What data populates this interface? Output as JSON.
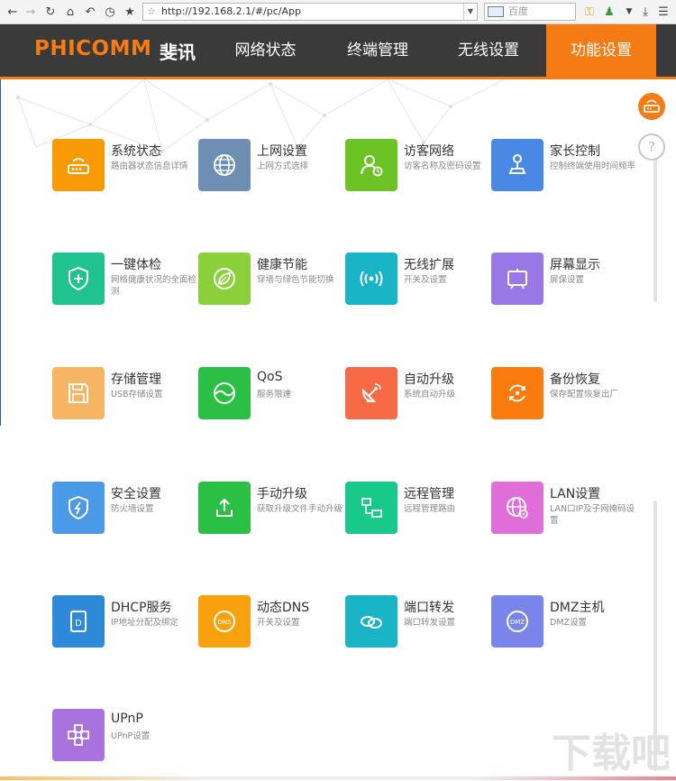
{
  "browser": {
    "url": "http://192.168.2.1/#/pc/App",
    "search_placeholder": "百度"
  },
  "header": {
    "brand_en": "PHICOMM",
    "brand_cn": "斐讯",
    "menu": [
      {
        "label": "网络状态",
        "active": false
      },
      {
        "label": "终端管理",
        "active": false
      },
      {
        "label": "无线设置",
        "active": false
      },
      {
        "label": "功能设置",
        "active": true
      }
    ]
  },
  "colors": {
    "accent": "#f57c14",
    "header_bg": "#3a3a3a"
  },
  "tiles": [
    {
      "title": "系统状态",
      "desc": "路由器状态信息详情",
      "color": "#f79a05",
      "icon": "router-icon"
    },
    {
      "title": "上网设置",
      "desc": "上网方式选择",
      "color": "#6f8fb2",
      "icon": "globe-icon"
    },
    {
      "title": "访客网络",
      "desc": "访客名称及密码设置",
      "color": "#6dc325",
      "icon": "guest-user-icon"
    },
    {
      "title": "家长控制",
      "desc": "控制终端使用时间频率",
      "color": "#4a88e6",
      "icon": "joystick-icon"
    },
    {
      "title": "一键体检",
      "desc": "网络健康状况的全面检测",
      "color": "#20c28e",
      "icon": "shield-plus-icon"
    },
    {
      "title": "健康节能",
      "desc": "穿墙与绿色节能切换",
      "color": "#8ad03a",
      "icon": "leaf-icon"
    },
    {
      "title": "无线扩展",
      "desc": "开关及设置",
      "color": "#18b4c6",
      "icon": "wireless-icon"
    },
    {
      "title": "屏幕显示",
      "desc": "屏保设置",
      "color": "#9977e4",
      "icon": "screen-icon"
    },
    {
      "title": "存储管理",
      "desc": "USB存储设置",
      "color": "#f6b562",
      "icon": "floppy-icon"
    },
    {
      "title": "QoS",
      "desc": "服务限速",
      "color": "#2cbf45",
      "icon": "qos-icon"
    },
    {
      "title": "自动升级",
      "desc": "系统自动升级",
      "color": "#f66a45",
      "icon": "satellite-icon"
    },
    {
      "title": "备份恢复",
      "desc": "保存配置恢复出厂",
      "color": "#fb7c0e",
      "icon": "restore-icon"
    },
    {
      "title": "安全设置",
      "desc": "防火墙设置",
      "color": "#4a9ae8",
      "icon": "shield-bolt-icon"
    },
    {
      "title": "手动升级",
      "desc": "获取升级文件手动升级",
      "color": "#2cbf45",
      "icon": "upload-icon"
    },
    {
      "title": "远程管理",
      "desc": "远程管理路由",
      "color": "#18c98a",
      "icon": "remote-icon"
    },
    {
      "title": "LAN设置",
      "desc": "LAN口IP及子网掩码设置",
      "color": "#df6ed8",
      "icon": "lan-globe-icon"
    },
    {
      "title": "DHCP服务",
      "desc": "IP地址分配及绑定",
      "color": "#2f89d9",
      "icon": "dhcp-icon"
    },
    {
      "title": "动态DNS",
      "desc": "开关及设置",
      "color": "#f7a10e",
      "icon": "dns-icon"
    },
    {
      "title": "端口转发",
      "desc": "端口转发设置",
      "color": "#18b4c6",
      "icon": "port-forward-icon"
    },
    {
      "title": "DMZ主机",
      "desc": "DMZ设置",
      "color": "#7985ea",
      "icon": "dmz-icon"
    },
    {
      "title": "UPnP",
      "desc": "UPnP设置",
      "color": "#a873dd",
      "icon": "upnp-icon"
    }
  ],
  "side": {
    "help_label": "?"
  },
  "watermark": {
    "text": "下载吧"
  }
}
